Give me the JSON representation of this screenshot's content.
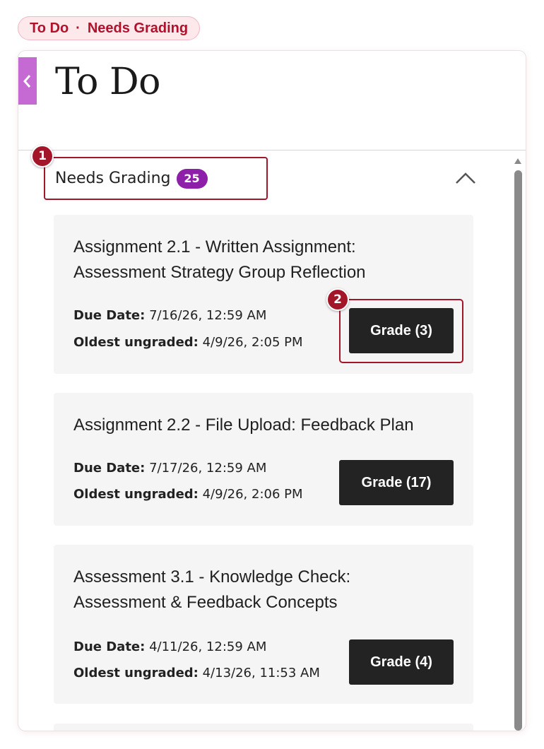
{
  "breadcrumb": {
    "part1": "To Do",
    "separator": "·",
    "part2": "Needs Grading"
  },
  "page": {
    "title": "To Do"
  },
  "section": {
    "title": "Needs Grading",
    "count": "25"
  },
  "markers": {
    "section": "1",
    "grade_button": "2"
  },
  "labels": {
    "due_date": "Due Date:",
    "oldest_ungraded": "Oldest ungraded:"
  },
  "items": [
    {
      "title": "Assignment 2.1 - Written Assignment: Assessment Strategy Group Reflection",
      "due_date": "7/16/26, 12:59 AM",
      "oldest_ungraded": "4/9/26, 2:05 PM",
      "grade_label": "Grade (3)"
    },
    {
      "title": "Assignment 2.2 - File Upload: Feedback Plan",
      "due_date": "7/17/26, 12:59 AM",
      "oldest_ungraded": "4/9/26, 2:06 PM",
      "grade_label": "Grade (17)"
    },
    {
      "title": "Assessment 3.1 - Knowledge Check: Assessment & Feedback Concepts",
      "due_date": "4/11/26, 12:59 AM",
      "oldest_ungraded": "4/13/26, 11:53 AM",
      "grade_label": "Grade (4)"
    }
  ],
  "icons": {
    "back": "chevron-left-icon",
    "collapse": "chevron-up-icon",
    "scroll_up": "scroll-up-arrow-icon"
  },
  "colors": {
    "accent_red": "#a3162a",
    "badge_purple": "#8e1fa8",
    "back_tab": "#c56ad3",
    "button_dark": "#232323",
    "card_bg": "#f5f5f5"
  }
}
